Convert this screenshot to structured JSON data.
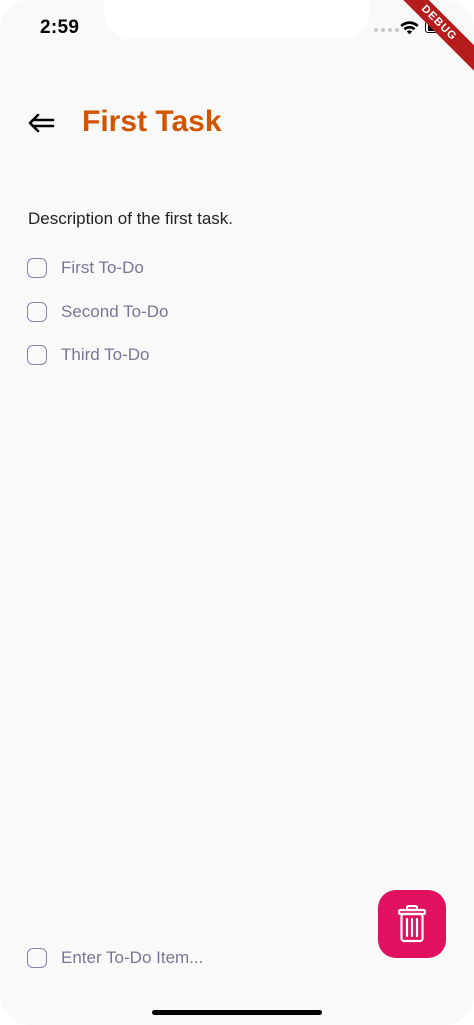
{
  "status_bar": {
    "time": "2:59"
  },
  "debug_banner": {
    "label": "DEBUG"
  },
  "header": {
    "title": "First Task",
    "back_icon": "back-arrow-icon",
    "title_color": "#d35400"
  },
  "task": {
    "description": "Description of the first task."
  },
  "todos": [
    {
      "label": "First To-Do",
      "checked": false
    },
    {
      "label": "Second To-Do",
      "checked": false
    },
    {
      "label": "Third To-Do",
      "checked": false
    }
  ],
  "new_todo": {
    "placeholder": "Enter To-Do Item..."
  },
  "fab": {
    "icon": "trash-icon",
    "color": "#e0115f"
  }
}
